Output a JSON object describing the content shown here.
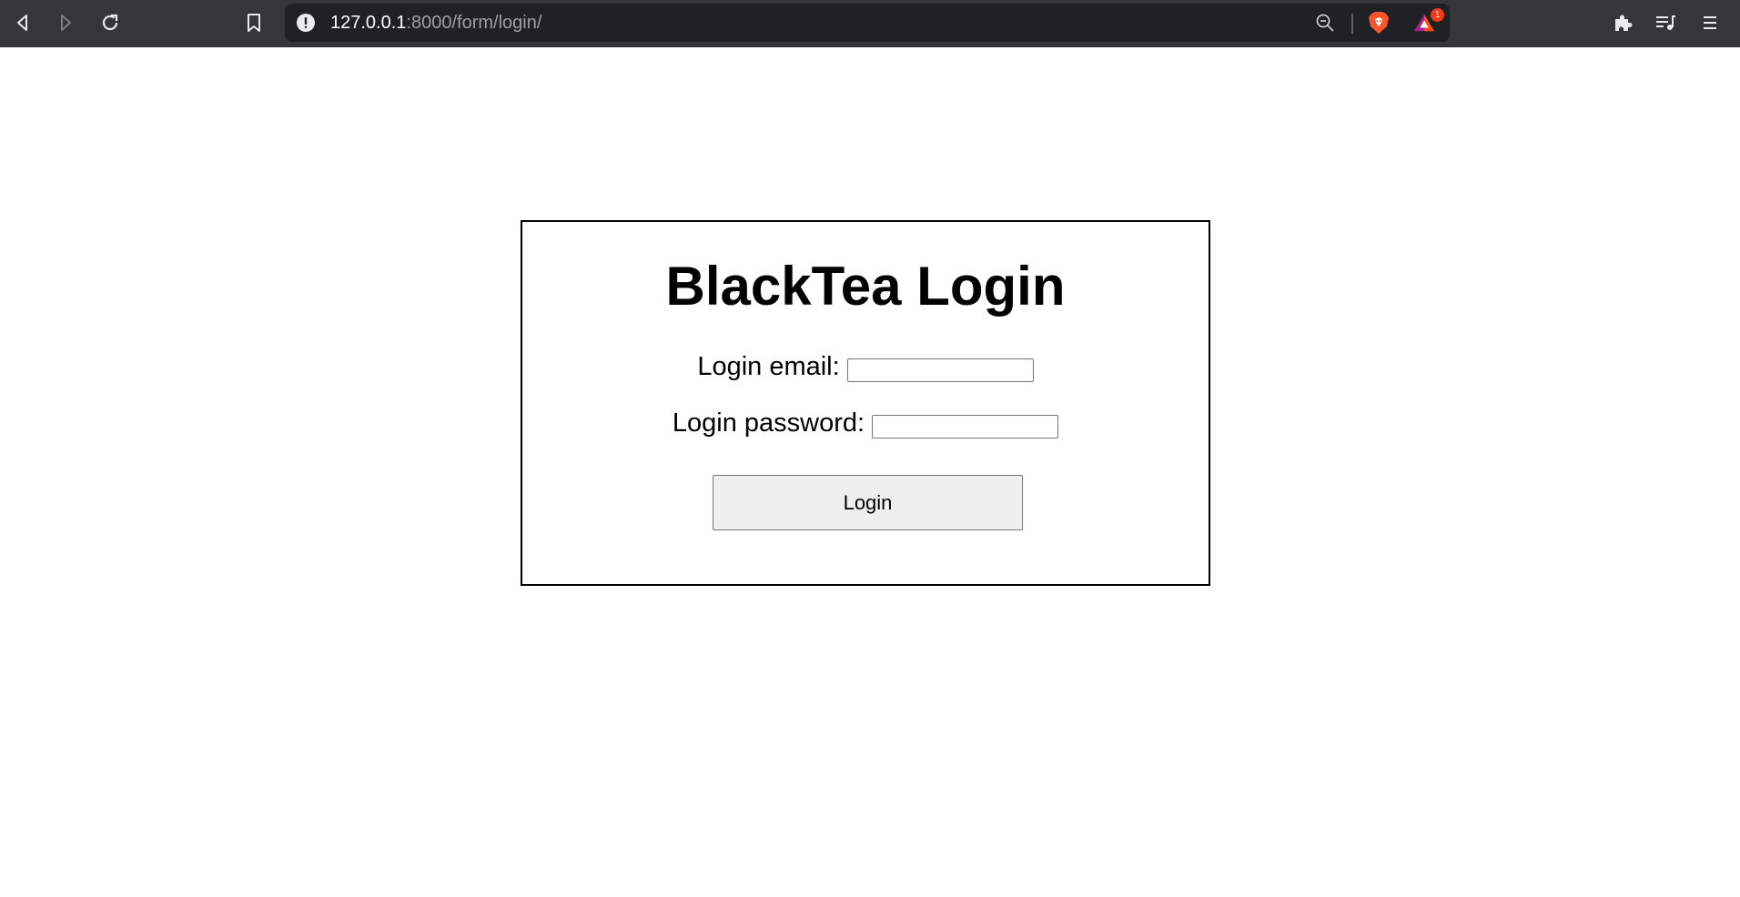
{
  "browser": {
    "url_host": "127.0.0.1",
    "url_rest": ":8000/form/login/",
    "notification_count": "1",
    "colors": {
      "toolbar_bg": "#35363a",
      "omnibox_bg": "#202124",
      "brave_orange": "#fb542b",
      "badge_red": "#f23c19"
    },
    "icons": [
      "back-icon",
      "forward-icon",
      "reload-icon",
      "bookmark-icon",
      "site-info-icon",
      "zoom-icon",
      "brave-shields-icon",
      "brave-rewards-icon",
      "extensions-icon",
      "media-queue-icon",
      "menu-icon"
    ]
  },
  "login": {
    "title": "BlackTea Login",
    "email_label": "Login email:",
    "email_value": "",
    "password_label": "Login password:",
    "password_value": "",
    "button_label": "Login"
  }
}
